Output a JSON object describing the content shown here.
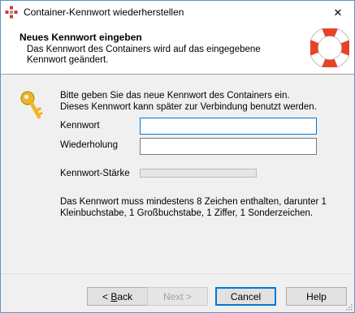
{
  "window": {
    "title": "Container-Kennwort wiederherstellen",
    "close_glyph": "✕"
  },
  "header": {
    "title": "Neues Kennwort eingeben",
    "description": "Das Kennwort des Containers wird auf das eingegebene Kennwort geändert."
  },
  "intro": {
    "line1": "Bitte geben Sie das neue Kennwort des Containers ein.",
    "line2": "Dieses Kennwort kann später zur Verbindung benutzt werden."
  },
  "form": {
    "password_label": "Kennwort",
    "password_value": "",
    "repeat_label": "Wiederholung",
    "repeat_value": "",
    "strength_label": "Kennwort-Stärke",
    "strength_fraction": 0
  },
  "rules": {
    "line1": "Das Kennwort muss mindestens 8 Zeichen enthalten, darunter 1",
    "line2": "Kleinbuchstabe, 1 Großbuchstabe, 1 Ziffer, 1 Sonderzeichen."
  },
  "buttons": {
    "back_prefix": "< ",
    "back_mnemonic": "B",
    "back_rest": "ack",
    "next_label": "Next >",
    "cancel_label": "Cancel",
    "help_label": "Help"
  },
  "icons": {
    "app": "container-app-icon",
    "key": "key-icon",
    "header": "lifebuoy-icon",
    "close": "close-icon"
  },
  "colors": {
    "accent": "#0078d7",
    "key": "#f0b428",
    "lifebuoy_red": "#e8432a"
  }
}
